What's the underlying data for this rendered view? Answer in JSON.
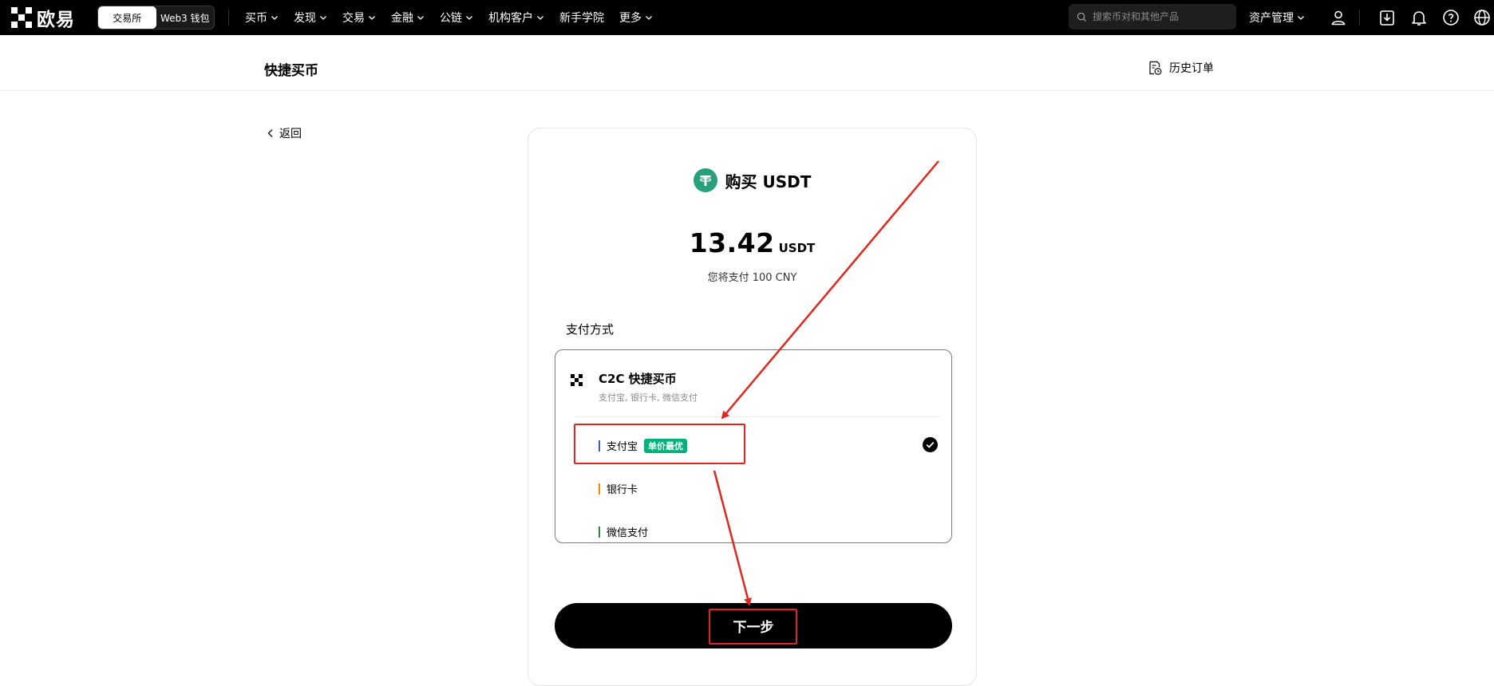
{
  "topbar": {
    "logo_text": "欧易",
    "switcher": {
      "exchange": "交易所",
      "wallet": "Web3 钱包"
    },
    "nav": [
      {
        "label": "买币",
        "has_dropdown": true
      },
      {
        "label": "发现",
        "has_dropdown": true
      },
      {
        "label": "交易",
        "has_dropdown": true
      },
      {
        "label": "金融",
        "has_dropdown": true
      },
      {
        "label": "公链",
        "has_dropdown": true
      },
      {
        "label": "机构客户",
        "has_dropdown": true
      },
      {
        "label": "新手学院",
        "has_dropdown": false
      },
      {
        "label": "更多",
        "has_dropdown": true
      }
    ],
    "search_placeholder": "搜索币对和其他产品",
    "asset_menu": "资产管理",
    "icons": [
      "user-icon",
      "download-icon",
      "bell-icon",
      "help-icon",
      "globe-icon"
    ]
  },
  "subheader": {
    "title": "快捷买币",
    "history_label": "历史订单"
  },
  "back_label": "返回",
  "card": {
    "buy_title": "购买 USDT",
    "amount": "13.42",
    "amount_unit": "USDT",
    "pay_note": "您将支付 100 CNY",
    "pay_method_label": "支付方式",
    "c2c": {
      "title": "C2C 快捷买币",
      "subtitle": "支付宝, 银行卡, 微信支付"
    },
    "options": [
      {
        "label": "支付宝",
        "badge": "单价最优",
        "bar_color": "#3b5bdb",
        "selected": true
      },
      {
        "label": "银行卡",
        "badge": "",
        "bar_color": "#f08c00",
        "selected": false
      },
      {
        "label": "微信支付",
        "badge": "",
        "bar_color": "#2b8a3e",
        "selected": false
      }
    ],
    "next_button": "下一步"
  },
  "colors": {
    "topbar_bg": "#000000",
    "brand_green": "#00b37e",
    "tether_green": "#26a17b",
    "annotation_red": "#e0271d"
  }
}
